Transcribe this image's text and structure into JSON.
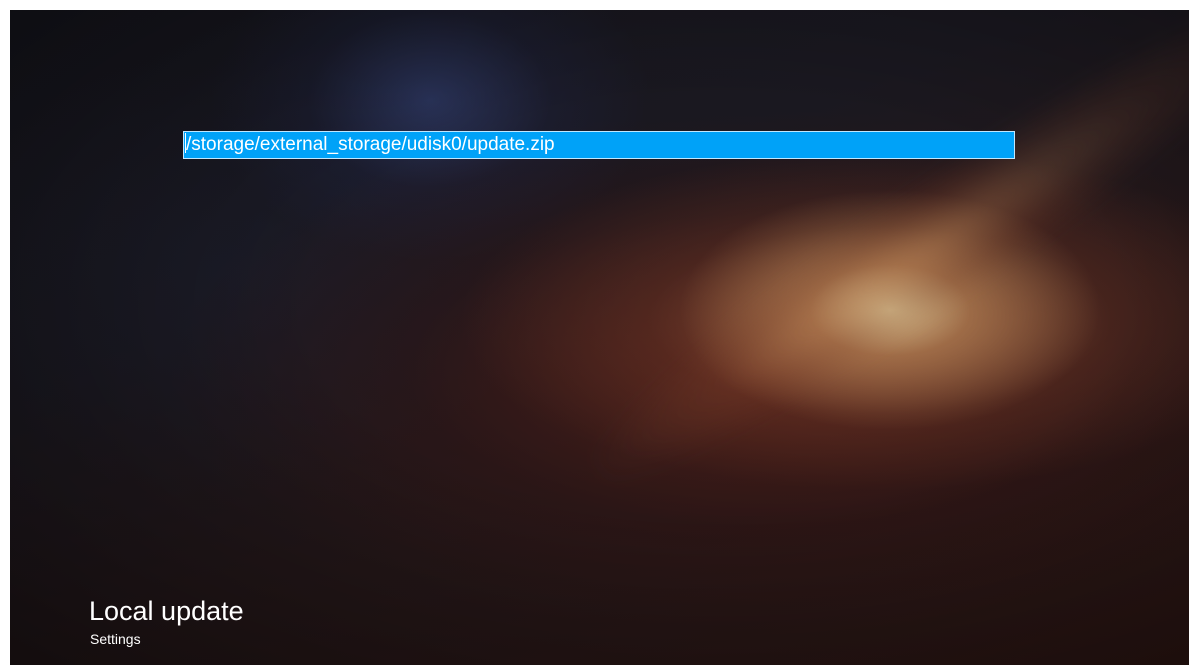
{
  "screen": {
    "background": "space-nebula-wallpaper"
  },
  "update_path": {
    "value": "/storage/external_storage/udisk0/update.zip",
    "highlight_color": "#00a2f8"
  },
  "header": {
    "title": "Local update",
    "subtitle": "Settings"
  }
}
